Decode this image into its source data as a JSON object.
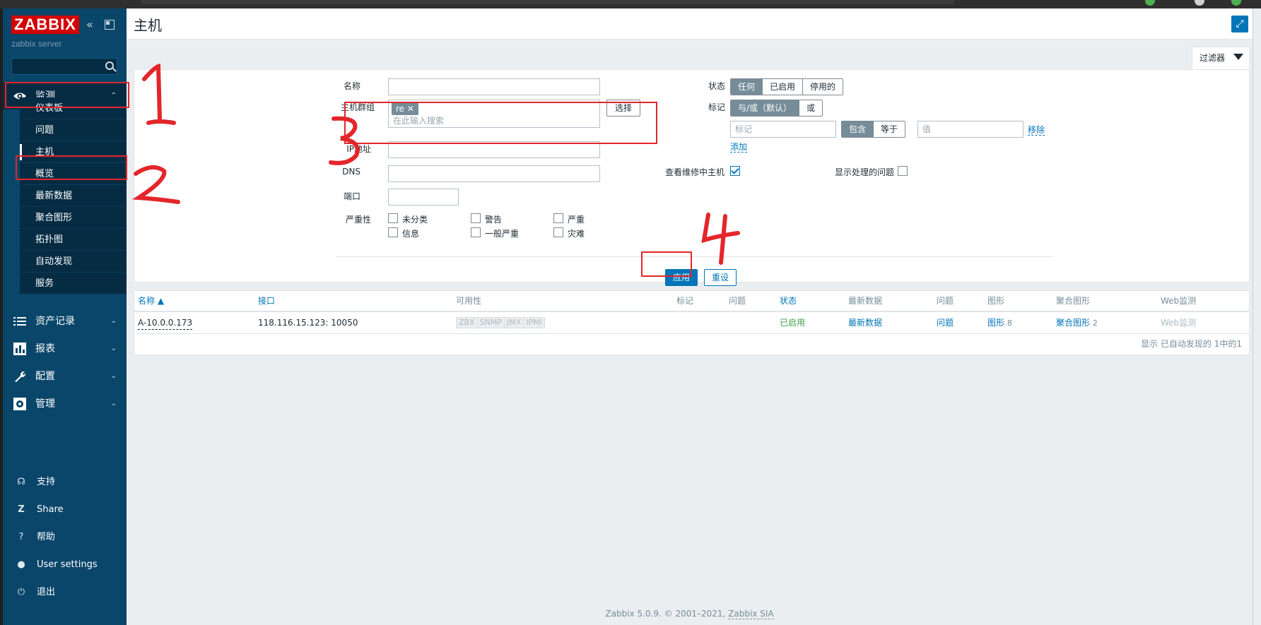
{
  "app": {
    "logo": "ZABBIX",
    "server_name": "zabbix server",
    "page_title": "主机",
    "copyright_prefix": "Zabbix 5.0.9. © 2001–2021, ",
    "copyright_link": "Zabbix SIA"
  },
  "sidebar": {
    "sections": [
      {
        "label": "监测",
        "icon": "eye-icon",
        "expanded": true
      },
      {
        "label": "资产记录",
        "icon": "list-icon"
      },
      {
        "label": "报表",
        "icon": "bar-chart-icon"
      },
      {
        "label": "配置",
        "icon": "wrench-icon"
      },
      {
        "label": "管理",
        "icon": "gear-icon"
      }
    ],
    "monitoring_items": [
      "仪表板",
      "问题",
      "主机",
      "概览",
      "最新数据",
      "聚合图形",
      "拓扑图",
      "自动发现",
      "服务"
    ],
    "selected_item": "主机",
    "bottom": [
      {
        "label": "支持",
        "icon": "headset-icon"
      },
      {
        "label": "Share",
        "icon": "share-icon"
      },
      {
        "label": "帮助",
        "icon": "help-icon"
      },
      {
        "label": "User settings",
        "icon": "user-icon"
      },
      {
        "label": "退出",
        "icon": "power-icon"
      }
    ]
  },
  "filter": {
    "tab_label": "过滤器",
    "name_label": "名称",
    "name_value": "",
    "hostgroup_label": "主机群组",
    "hostgroup_chip": "re",
    "hostgroup_placeholder": "在此输入搜索",
    "select_button": "选择",
    "ip_label": "IP地址",
    "dns_label": "DNS",
    "port_label": "端口",
    "severity_label": "严重性",
    "severities": [
      "未分类",
      "警告",
      "严重",
      "信息",
      "一般严重",
      "灾难"
    ],
    "status_label": "状态",
    "status_options": [
      "任何",
      "已启用",
      "停用的"
    ],
    "status_selected": "任何",
    "tags_label": "标记",
    "tag_operator_options": [
      "与/或（默认）",
      "或"
    ],
    "tag_operator_selected": "与/或（默认）",
    "tag_placeholder": "标记",
    "tag_match_options": [
      "包含",
      "等于"
    ],
    "tag_match_selected": "包含",
    "value_placeholder": "值",
    "remove_link": "移除",
    "add_link": "添加",
    "maintenance_label": "查看维修中主机",
    "maintenance_checked": true,
    "suppressed_label": "显示处理的问题",
    "suppressed_checked": false,
    "apply_button": "应用",
    "reset_button": "重设"
  },
  "table": {
    "columns": [
      "名称 ▲",
      "接口",
      "可用性",
      "标记",
      "问题",
      "状态",
      "最新数据",
      "问题",
      "图形",
      "聚合图形",
      "Web监测"
    ],
    "rows": [
      {
        "name": "A-10.0.0.173",
        "interface": "118.116.15.123: 10050",
        "availability": [
          "ZBX",
          "SNMP",
          "JMX",
          "IPMI"
        ],
        "tags": "",
        "problems": "",
        "status": "已启用",
        "latest_data": "最新数据",
        "problems_link": "问题",
        "graphs": "图形",
        "graphs_count": "8",
        "screens": "聚合图形",
        "screens_count": "2",
        "web": "Web监测"
      }
    ],
    "footer": "显示 已自动发现的 1中的1"
  },
  "annotations": [
    "1",
    "2",
    "3",
    "4"
  ],
  "colors": {
    "sidebar_bg": "#0a466a",
    "accent": "#0275b8",
    "logo_red": "#d40000",
    "annotation_red": "#e3262a",
    "status_green": "#429e47"
  }
}
